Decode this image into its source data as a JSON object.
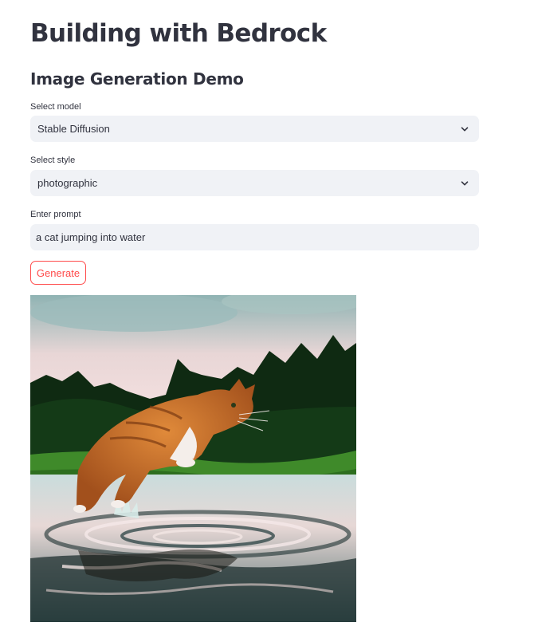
{
  "page": {
    "title": "Building with Bedrock",
    "subtitle": "Image Generation Demo"
  },
  "form": {
    "model": {
      "label": "Select model",
      "selected": "Stable Diffusion"
    },
    "style": {
      "label": "Select style",
      "selected": "photographic"
    },
    "prompt": {
      "label": "Enter prompt",
      "value": "a cat jumping into water"
    },
    "generate_label": "Generate"
  },
  "result": {
    "image_description": "a cat jumping into water",
    "icon": "generated-image"
  },
  "colors": {
    "accent": "#ff4b4b",
    "text": "#31333f",
    "input_bg": "#f0f2f6"
  }
}
